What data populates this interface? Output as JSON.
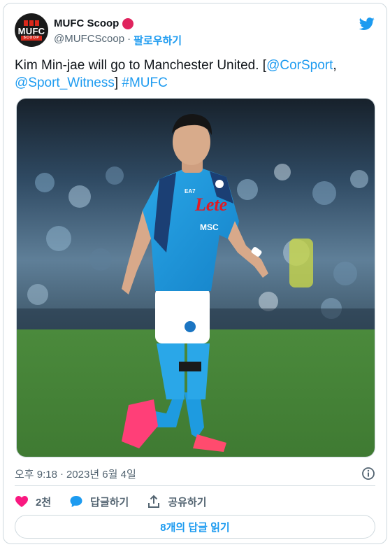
{
  "author": {
    "display_name": "MUFC Scoop",
    "handle": "@MUFCScoop",
    "separator": "·",
    "follow_label": "팔로우하기",
    "avatar_text": "MUFC",
    "avatar_subtext": "SCOOP",
    "badge_color": "#e0245e"
  },
  "tweet": {
    "text_main": "Kim Min-jae will go to Manchester United. [",
    "mention_1": "@CorSport",
    "comma": ",",
    "mention_2": "@Sport_Witness",
    "bracket_close": "]",
    "hashtag": "#MUFC",
    "image_alt": "Football player in blue Napoli kit on pitch",
    "kit_sponsor": "Lete",
    "kit_sponsor_2": "MSC",
    "kit_brand": "EA7"
  },
  "meta": {
    "time": "오후 9:18",
    "separator": "·",
    "date": "2023년 6월 4일"
  },
  "actions": {
    "like_count": "2천",
    "reply_label": "답글하기",
    "share_label": "공유하기"
  },
  "replies_button_label": "8개의 답글 읽기",
  "colors": {
    "accent": "#1d9bf0",
    "like": "#f91880",
    "text": "#0f1419",
    "muted": "#536471",
    "border": "#cfd9de"
  },
  "icons": [
    "twitter-bird-icon",
    "info-icon",
    "heart-icon",
    "reply-bubble-icon",
    "share-upload-icon"
  ]
}
